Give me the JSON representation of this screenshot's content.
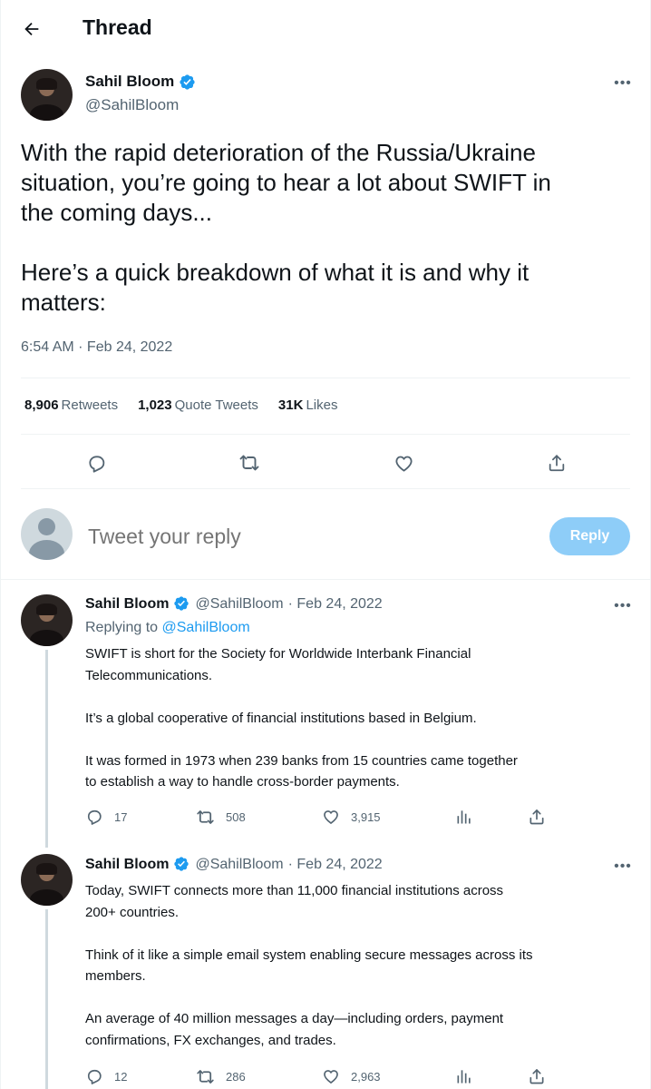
{
  "header": {
    "title": "Thread"
  },
  "main_tweet": {
    "author_name": "Sahil Bloom",
    "author_handle": "@SahilBloom",
    "text": "With the rapid deterioration of the Russia/Ukraine\nsituation, you’re going to hear a lot about SWIFT in\nthe coming days...\n\nHere’s a quick breakdown of what it is and why it\nmatters:",
    "timestamp": "6:54 AM · Feb 24, 2022",
    "stats": {
      "retweets_count": "8,906",
      "retweets_label": "Retweets",
      "quotes_count": "1,023",
      "quotes_label": "Quote Tweets",
      "likes_count": "31K",
      "likes_label": "Likes"
    }
  },
  "reply_box": {
    "placeholder": "Tweet your reply",
    "button_label": "Reply"
  },
  "replies": [
    {
      "author_name": "Sahil Bloom",
      "author_handle": "@SahilBloom",
      "date": "· Feb 24, 2022",
      "replying_label": "Replying to",
      "replying_to": "@SahilBloom",
      "text": "SWIFT is short for the Society for Worldwide Interbank Financial\nTelecommunications.\n\nIt’s a global cooperative of financial institutions based in Belgium.\n\nIt was formed in 1973 when 239 banks from 15 countries came together\nto establish a way to handle cross-border payments.",
      "replies": "17",
      "retweets": "508",
      "likes": "3,915"
    },
    {
      "author_name": "Sahil Bloom",
      "author_handle": "@SahilBloom",
      "date": "· Feb 24, 2022",
      "text": "Today, SWIFT connects more than 11,000 financial institutions across\n200+ countries.\n\nThink of it like a simple email system enabling secure messages across its\nmembers.\n\nAn average of 40 million messages a day—including orders, payment\nconfirmations, FX exchanges, and trades.",
      "replies": "12",
      "retweets": "286",
      "likes": "2,963"
    }
  ],
  "icons": {
    "back": "arrow-left-icon",
    "more": "more-icon",
    "verified": "verified-badge-icon",
    "reply": "reply-icon",
    "retweet": "retweet-icon",
    "like": "heart-icon",
    "share": "share-icon",
    "analytics": "analytics-icon"
  },
  "colors": {
    "accent": "#1d9bf0",
    "reply_button": "#8ecdf8",
    "secondary_text": "#536471",
    "divider": "#eff3f4"
  }
}
